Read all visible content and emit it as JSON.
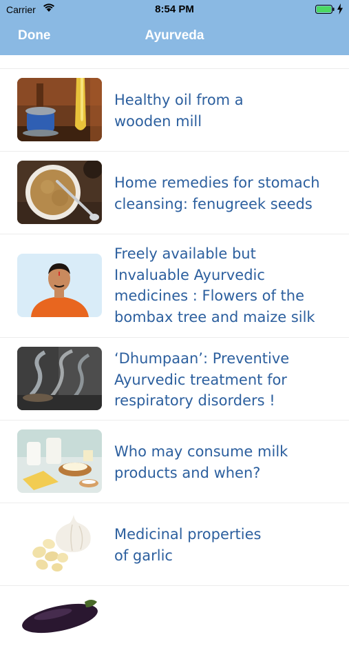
{
  "status_bar": {
    "carrier": "Carrier",
    "time": "8:54 PM",
    "battery_color": "#4cd964"
  },
  "nav": {
    "done_label": "Done",
    "title": "Ayurveda",
    "background_color": "#8ab9e3"
  },
  "articles": [
    {
      "title": "Healthy oil from a\nwooden mill",
      "image": "wooden-oil-mill-photo"
    },
    {
      "title": "Home remedies for stomach\ncleansing: fenugreek seeds",
      "image": "fenugreek-seeds-bowl-photo"
    },
    {
      "title": "Freely available but\nInvaluable Ayurvedic\nmedicines : Flowers of the\nbombax tree and maize silk",
      "image": "man-portrait-photo"
    },
    {
      "title": "‘Dhumpaan’: Preventive\nAyurvedic treatment for\nrespiratory disorders !",
      "image": "smoke-incense-photo"
    },
    {
      "title": "Who may consume milk\nproducts and when?",
      "image": "milk-products-photo"
    },
    {
      "title": "Medicinal properties\nof garlic",
      "image": "garlic-photo"
    },
    {
      "title": "",
      "image": "eggplant-photo"
    }
  ],
  "colors": {
    "title_text": "#2c5f9e",
    "separator": "#ececec"
  }
}
